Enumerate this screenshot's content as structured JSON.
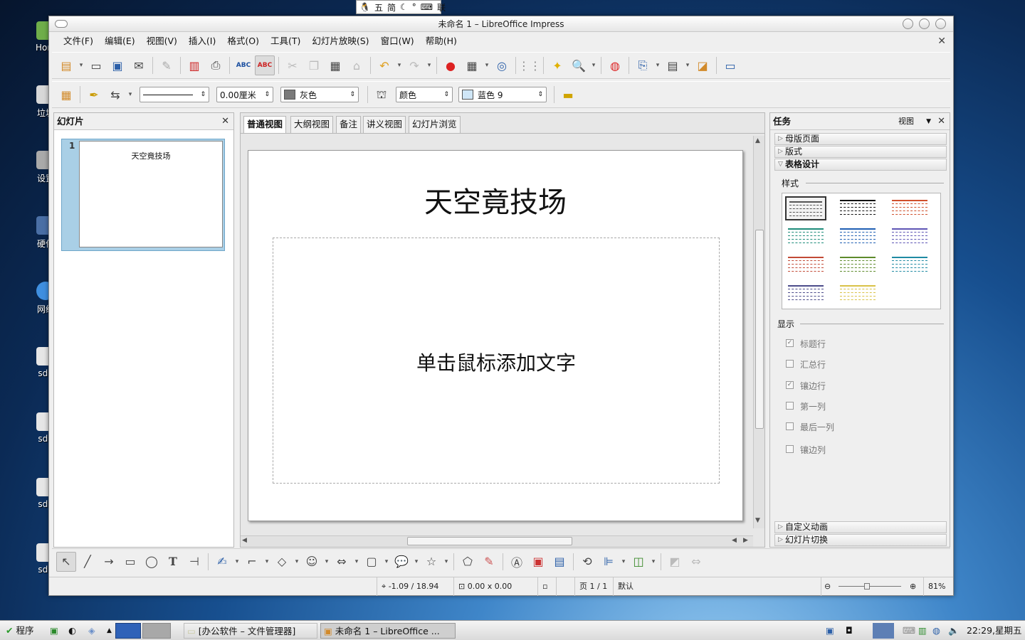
{
  "ime": {
    "items": [
      "五",
      "简",
      "联"
    ]
  },
  "desktop": {
    "icons": [
      "Hom",
      "垃圾",
      "设置",
      "硬件",
      "网络",
      "sda",
      "sda",
      "sda",
      "sda"
    ]
  },
  "window": {
    "title": "未命名 1 – LibreOffice Impress",
    "menu": [
      "文件(F)",
      "编辑(E)",
      "视图(V)",
      "插入(I)",
      "格式(O)",
      "工具(T)",
      "幻灯片放映(S)",
      "窗口(W)",
      "帮助(H)"
    ]
  },
  "format_toolbar": {
    "line_width": "0.00厘米",
    "line_color": "灰色",
    "area_style": "颜色",
    "area_color": "蓝色 9",
    "line_color_hex": "#7a7a7a",
    "area_color_hex": "#cfe6f7"
  },
  "slides_panel": {
    "title": "幻灯片",
    "slides": [
      {
        "number": "1",
        "title": "天空竟技场"
      }
    ]
  },
  "editor": {
    "tabs": [
      "普通视图",
      "大纲视图",
      "备注",
      "讲义视图",
      "幻灯片浏览"
    ],
    "active_tab": "普通视图",
    "slide_title": "天空竟技场",
    "placeholder": "单击鼠标添加文字"
  },
  "task_panel": {
    "title": "任务",
    "view_label": "视图",
    "sections": [
      "母版页面",
      "版式",
      "表格设计"
    ],
    "bottom_sections": [
      "自定义动画",
      "幻灯片切换"
    ],
    "style_label": "样式",
    "display_label": "显示",
    "table_style_colors": [
      "#555555",
      "#111111",
      "#d0502c",
      "#1d8c7a",
      "#1f5fb3",
      "#5e55b5",
      "#c24a36",
      "#5d8a2a",
      "#1f8aa3",
      "#4b4b8a",
      "#d9c246"
    ],
    "options": [
      {
        "label": "标题行",
        "checked": true
      },
      {
        "label": "汇总行",
        "checked": false
      },
      {
        "label": "镶边行",
        "checked": true
      },
      {
        "label": "第一列",
        "checked": false
      },
      {
        "label": "最后一列",
        "checked": false
      },
      {
        "label": "镶边列",
        "checked": false
      }
    ]
  },
  "statusbar": {
    "position": "-1.09 / 18.94",
    "size": "0.00 x 0.00",
    "page": "页 1 / 1",
    "layout": "默认",
    "zoom": "81%"
  },
  "taskbar": {
    "start": "程序",
    "tasks": [
      "[办公软件 – 文件管理器]",
      "未命名 1 – LibreOffice ..."
    ],
    "clock": "22:29,星期五"
  }
}
